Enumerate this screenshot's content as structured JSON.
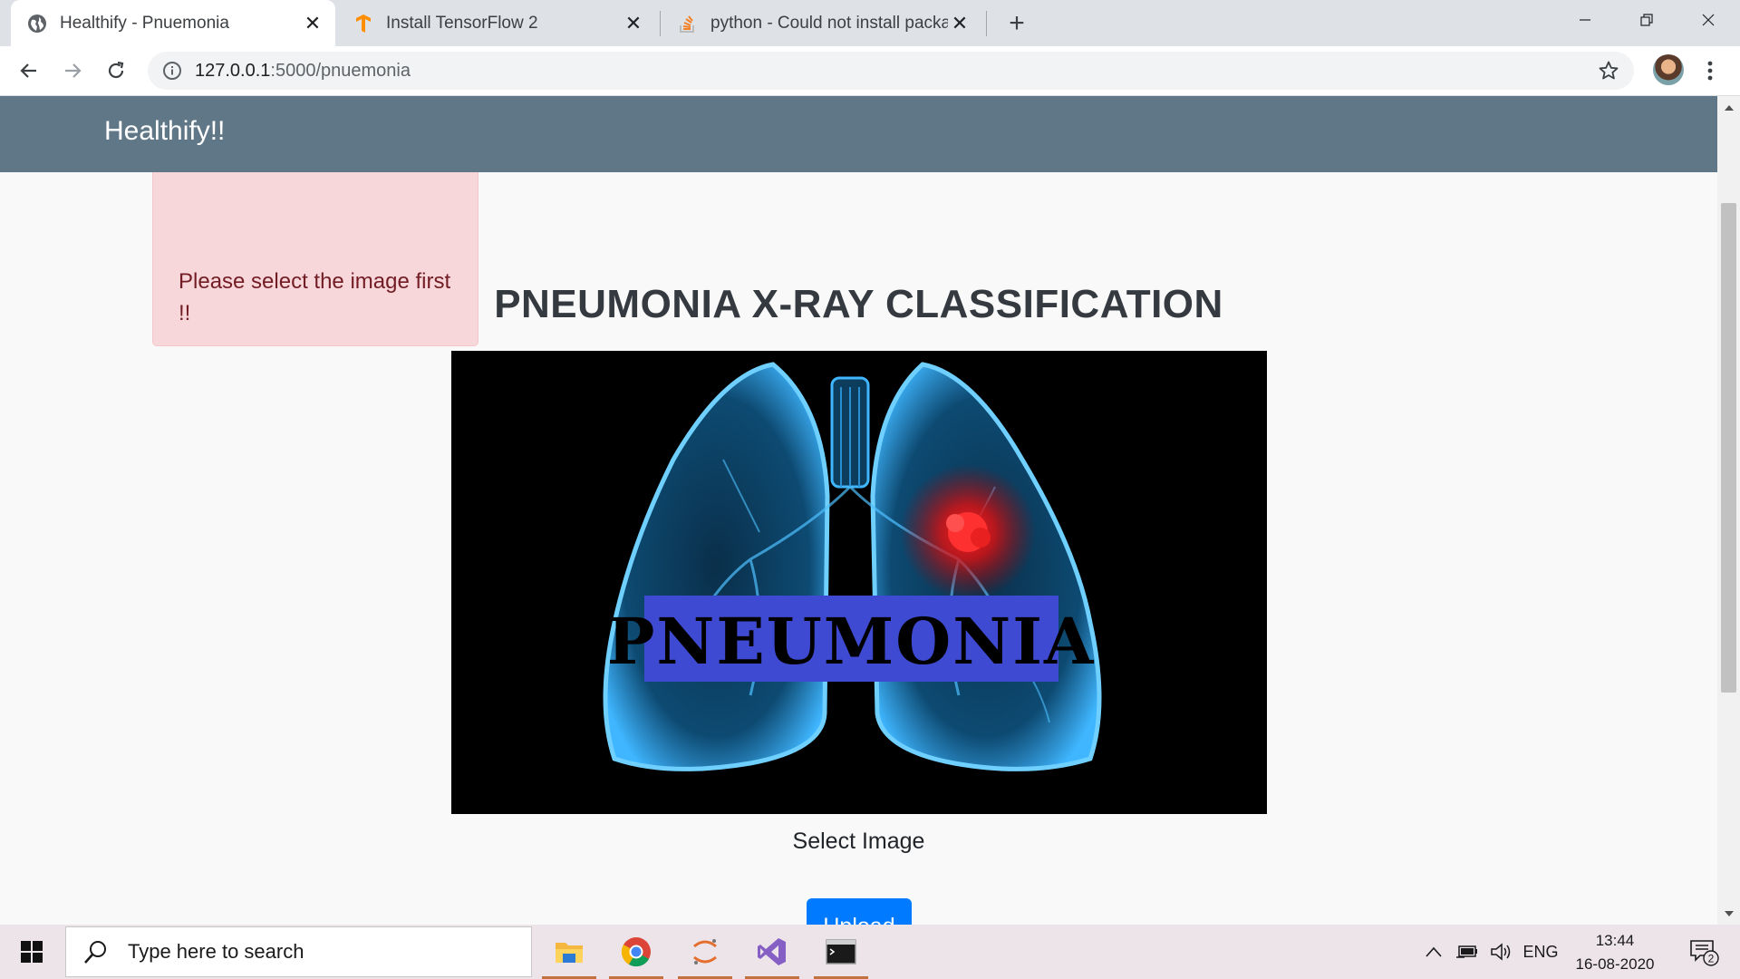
{
  "browser": {
    "tabs": [
      {
        "title": "Healthify - Pnuemonia",
        "icon": "globe-icon",
        "active": true
      },
      {
        "title": "Install TensorFlow 2",
        "icon": "tensorflow-icon",
        "active": false
      },
      {
        "title": "python - Could not install packag",
        "icon": "stackoverflow-icon",
        "active": false
      }
    ],
    "url_host": "127.0.0.1",
    "url_path": ":5000/pnuemonia"
  },
  "page": {
    "brand": "Healthify!!",
    "alert_line1": "Please select the image first",
    "alert_line2": "!!",
    "heading": "PNEUMONIA X-RAY CLASSIFICATION",
    "hero_text": "PNEUMONIA",
    "select_label": "Select Image",
    "upload_label": "Upload"
  },
  "taskbar": {
    "search_placeholder": "Type here to search",
    "language": "ENG",
    "time": "13:44",
    "date": "16-08-2020",
    "notification_count": "2"
  },
  "colors": {
    "navbar": "#607788",
    "alert_bg": "#f8d7da",
    "alert_text": "#721c24",
    "primary": "#007bff"
  }
}
